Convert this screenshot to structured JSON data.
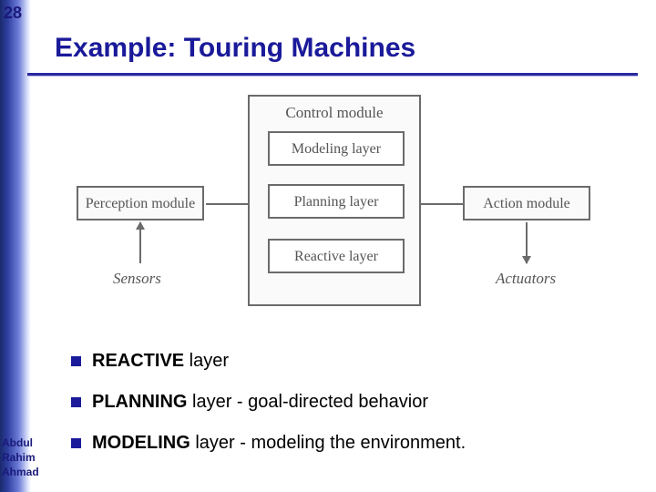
{
  "page_number": "28",
  "title": "Example: Touring Machines",
  "diagram": {
    "control_module": "Control module",
    "layers": [
      "Modeling layer",
      "Planning layer",
      "Reactive layer"
    ],
    "perception": "Perception module",
    "action": "Action module",
    "sensors": "Sensors",
    "actuators": "Actuators"
  },
  "bullets": [
    {
      "bold": "REACTIVE",
      "rest": " layer"
    },
    {
      "bold": "PLANNING",
      "rest": " layer - goal-directed behavior"
    },
    {
      "bold": "MODELING",
      "rest": " layer - modeling the environment."
    }
  ],
  "author": {
    "l1": "Abdul",
    "l2": "Rahim",
    "l3": "Ahmad"
  }
}
